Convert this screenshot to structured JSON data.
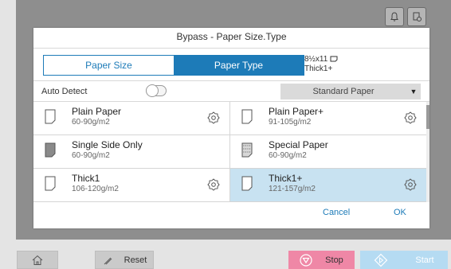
{
  "dialog": {
    "title": "Bypass - Paper Size.Type",
    "tabs": [
      {
        "label": "Paper Size",
        "active": false
      },
      {
        "label": "Paper Type",
        "active": true
      }
    ],
    "summary": {
      "size": "8½x11",
      "type": "Thick1+"
    },
    "auto_detect": {
      "label": "Auto Detect",
      "on": false
    },
    "dropdown": {
      "value": "Standard Paper"
    },
    "papers": [
      {
        "name": "Plain Paper",
        "spec": "60-90g/m2",
        "gear": true,
        "selected": false,
        "icon": "plain-paper-icon"
      },
      {
        "name": "Plain Paper+",
        "spec": "91-105g/m2",
        "gear": true,
        "selected": false,
        "icon": "plain-paper-icon"
      },
      {
        "name": "Single Side Only",
        "spec": "60-90g/m2",
        "gear": false,
        "selected": false,
        "icon": "single-side-paper-icon"
      },
      {
        "name": "Special Paper",
        "spec": "60-90g/m2",
        "gear": false,
        "selected": false,
        "icon": "special-paper-icon"
      },
      {
        "name": "Thick1",
        "spec": "106-120g/m2",
        "gear": true,
        "selected": false,
        "icon": "plain-paper-icon"
      },
      {
        "name": "Thick1+",
        "spec": "121-157g/m2",
        "gear": true,
        "selected": true,
        "icon": "plain-paper-icon"
      }
    ],
    "cancel_label": "Cancel",
    "ok_label": "OK"
  },
  "bottom_bar": {
    "reset_label": "Reset",
    "stop_label": "Stop",
    "start_label": "Start"
  },
  "colors": {
    "accent": "#1d7bb8",
    "selected": "#c8e2f1",
    "stop": "#ef87a6",
    "start": "#b5dbf2"
  }
}
